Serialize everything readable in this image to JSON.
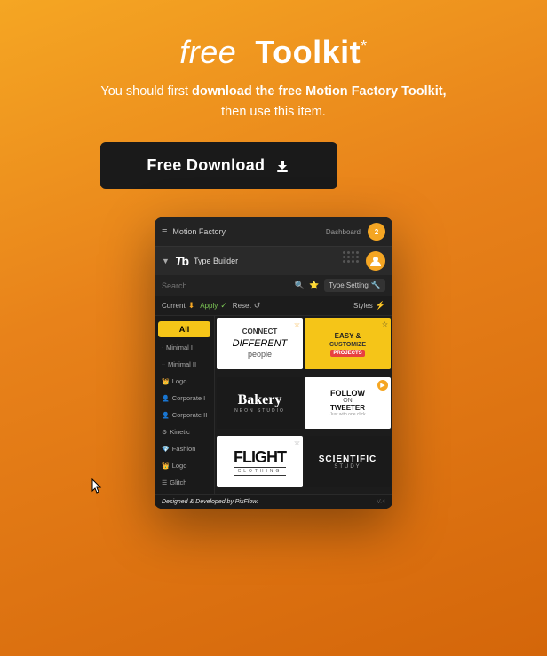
{
  "header": {
    "title_free": "free",
    "title_toolkit": "Toolkit",
    "title_star": "*",
    "subtitle_line1_pre": "You should first",
    "subtitle_highlight": "download the free",
    "subtitle_brand": "Motion Factory",
    "subtitle_suffix": "Toolkit,",
    "subtitle_line2": "then use this item.",
    "download_btn": "Free Download",
    "download_icon": "⬇"
  },
  "app": {
    "topbar": {
      "brand": "Motion Factory",
      "menu_icon": "≡",
      "dashboard_label": "Dashboard",
      "notification_count": "2"
    },
    "type_builder": {
      "logo": "Tb",
      "label": "Type Builder"
    },
    "search": {
      "placeholder": "Search...",
      "type_setting": "Type Setting"
    },
    "toolbar": {
      "current": "Current",
      "apply": "Apply",
      "reset": "Reset",
      "styles": "Styles"
    },
    "sidebar": {
      "items": [
        {
          "label": "All",
          "active": true,
          "prefix": ""
        },
        {
          "label": "Minimal I",
          "active": false,
          "prefix": "·"
        },
        {
          "label": "Minimal II",
          "active": false,
          "prefix": "··"
        },
        {
          "label": "Logo",
          "active": false,
          "prefix": "🎩"
        },
        {
          "label": "Corporate I",
          "active": false,
          "prefix": "👤"
        },
        {
          "label": "Corporate II",
          "active": false,
          "prefix": "👤"
        },
        {
          "label": "Kinetic",
          "active": false,
          "prefix": "⚙"
        },
        {
          "label": "Fashion",
          "active": false,
          "prefix": "💎"
        },
        {
          "label": "Logo",
          "active": false,
          "prefix": "🎩"
        },
        {
          "label": "Glitch",
          "active": false,
          "prefix": "☰"
        }
      ]
    },
    "grid": {
      "cells": [
        {
          "id": 1,
          "type": "connect"
        },
        {
          "id": 2,
          "type": "easy_customize"
        },
        {
          "id": 3,
          "type": "bakery"
        },
        {
          "id": 4,
          "type": "follow_tweeter"
        },
        {
          "id": 5,
          "type": "flight"
        },
        {
          "id": 6,
          "type": "scientific"
        }
      ]
    },
    "footer": {
      "designed_by": "Designed & Developed by",
      "brand": "PixFlow.",
      "version": "V.4"
    }
  }
}
